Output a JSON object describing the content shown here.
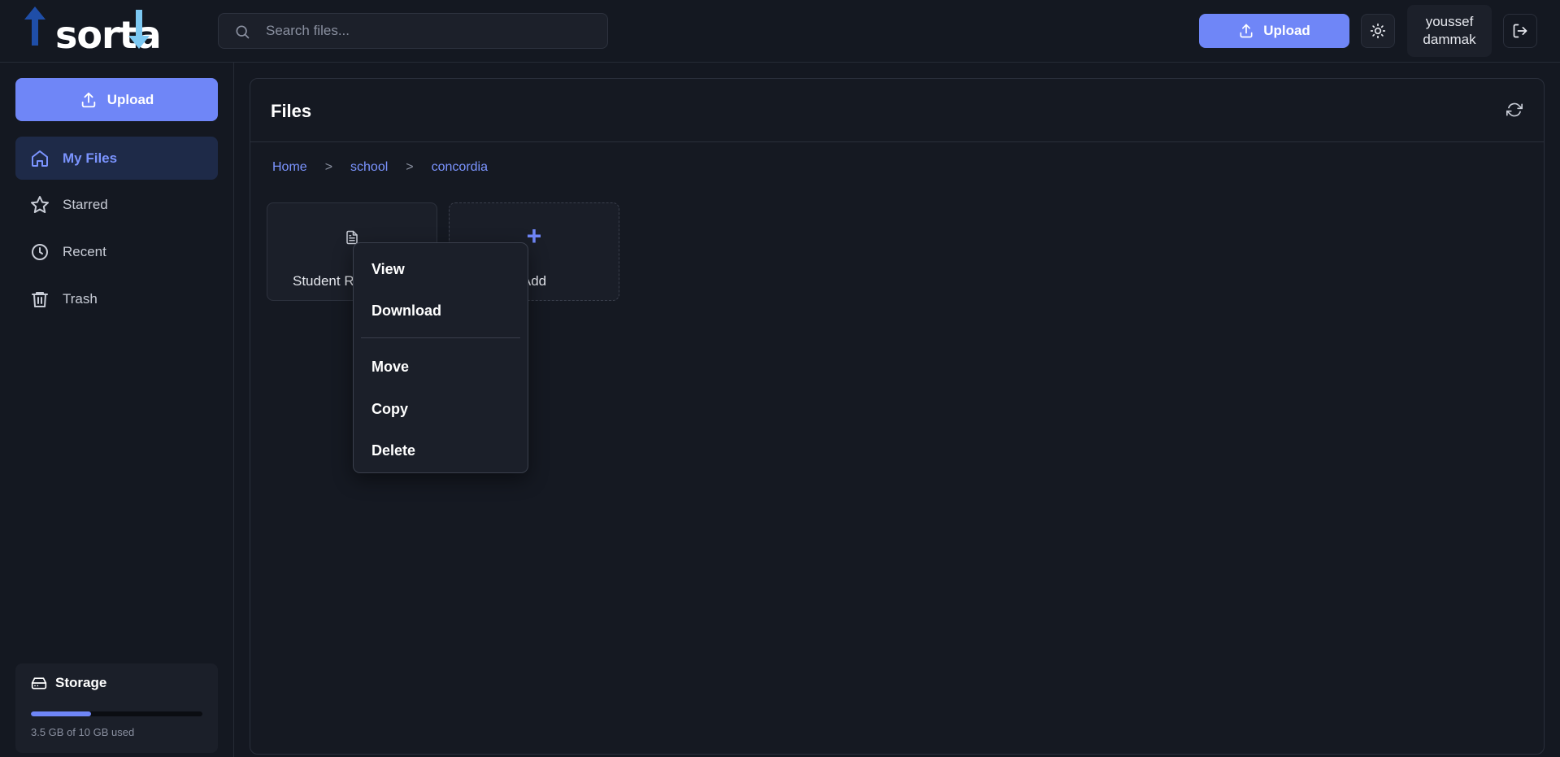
{
  "header": {
    "logo_text": "sorta",
    "search_placeholder": "Search files...",
    "upload_label": "Upload",
    "user_first": "youssef",
    "user_last": "dammak"
  },
  "sidebar": {
    "upload_label": "Upload",
    "items": [
      {
        "label": "My Files",
        "icon": "home-icon",
        "active": true
      },
      {
        "label": "Starred",
        "icon": "star-icon",
        "active": false
      },
      {
        "label": "Recent",
        "icon": "clock-icon",
        "active": false
      },
      {
        "label": "Trash",
        "icon": "trash-icon",
        "active": false
      }
    ],
    "storage": {
      "title": "Storage",
      "usage_text": "3.5 GB of 10 GB used",
      "used_fraction": 0.35
    }
  },
  "main": {
    "title": "Files",
    "breadcrumb": [
      "Home",
      "school",
      "concordia"
    ],
    "breadcrumb_separator": ">",
    "files": [
      {
        "name": "Student Re",
        "icon": "document-icon"
      }
    ],
    "add_card_label": "Add"
  },
  "context_menu": {
    "items": [
      "View",
      "Download",
      "Move",
      "Copy",
      "Delete"
    ]
  },
  "colors": {
    "accent": "#6f86f7",
    "background": "#141821",
    "active_nav_bg": "#1e2a48",
    "logo_dark_arrow": "#1f4ea8",
    "logo_light_arrow": "#7cc8f2"
  }
}
